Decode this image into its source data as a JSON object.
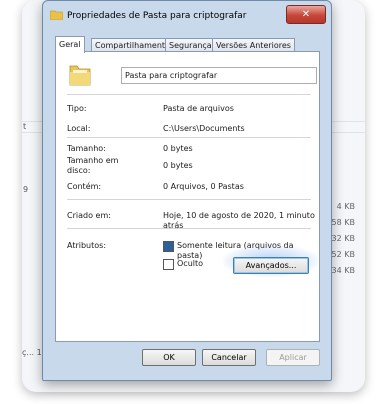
{
  "window": {
    "title": "Propriedades de Pasta para criptografar",
    "close_label": "✕"
  },
  "tabs": [
    {
      "label": "Geral",
      "active": true
    },
    {
      "label": "Compartilhamento",
      "active": false
    },
    {
      "label": "Segurança",
      "active": false
    },
    {
      "label": "Versões Anteriores",
      "active": false
    }
  ],
  "general": {
    "folder_name": "Pasta para criptografar",
    "type_label": "Tipo:",
    "type_value": "Pasta de arquivos",
    "location_label": "Local:",
    "location_value": "C:\\Users\\Documents",
    "size_label": "Tamanho:",
    "size_value": "0 bytes",
    "disk_size_label": "Tamanho em disco:",
    "disk_size_value": "0 bytes",
    "contains_label": "Contém:",
    "contains_value": "0 Arquivos, 0 Pastas",
    "created_label": "Criado em:",
    "created_value": "Hoje, 10 de agosto de 2020, 1 minuto atrás",
    "attributes_label": "Atributos:",
    "readonly_label": "Somente leitura (arquivos da pasta)",
    "readonly_checked": true,
    "hidden_label": "Oculto",
    "hidden_checked": false,
    "advanced_button": "Avançados..."
  },
  "footer": {
    "ok": "OK",
    "cancel": "Cancelar",
    "apply": "Aplicar"
  },
  "background": {
    "left_fragment_1": "t",
    "left_fragment_2": "9",
    "bottom_fragment": "ç... 1(",
    "sizes": [
      "4 KB",
      "58 KB",
      "32 KB",
      "52 KB",
      "34 KB"
    ]
  },
  "colors": {
    "dialog_frame": "#c9d9ec",
    "close_button": "#c8473a",
    "checkbox_checked": "#2d5f9a"
  }
}
